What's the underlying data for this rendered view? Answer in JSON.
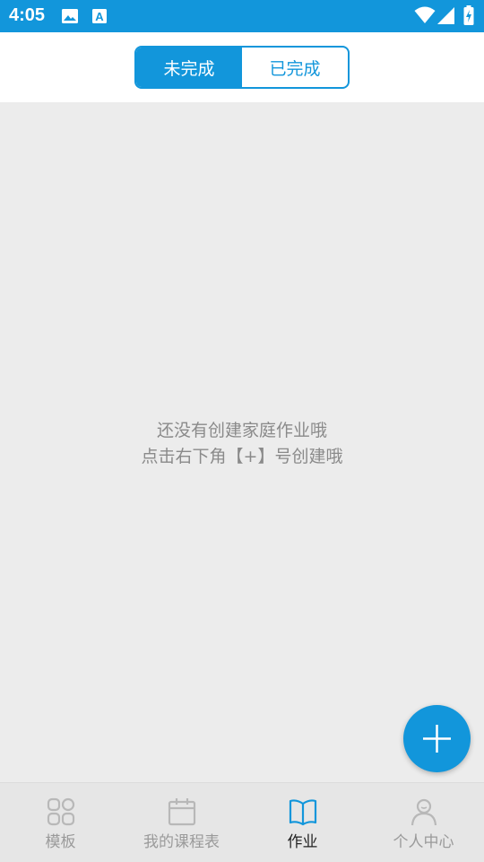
{
  "status_bar": {
    "time": "4:05",
    "left_icons": [
      "image-icon",
      "font-a-icon"
    ],
    "right_icons": [
      "wifi-icon",
      "signal-icon",
      "battery-charging-icon"
    ],
    "color": "#1296db"
  },
  "segmented_control": {
    "tabs": [
      {
        "label": "未完成",
        "active": true
      },
      {
        "label": "已完成",
        "active": false
      }
    ],
    "accent": "#1296db"
  },
  "empty_state": {
    "line1": "还没有创建家庭作业哦",
    "line2": "点击右下角【+】号创建哦"
  },
  "fab": {
    "icon": "plus-icon"
  },
  "bottom_nav": {
    "items": [
      {
        "label": "模板",
        "icon": "grid-icon",
        "active": false
      },
      {
        "label": "我的课程表",
        "icon": "calendar-icon",
        "active": false
      },
      {
        "label": "作业",
        "icon": "book-icon",
        "active": true
      },
      {
        "label": "个人中心",
        "icon": "person-icon",
        "active": false
      }
    ],
    "active_color": "#1296db",
    "inactive_color": "#b8b8b8"
  }
}
